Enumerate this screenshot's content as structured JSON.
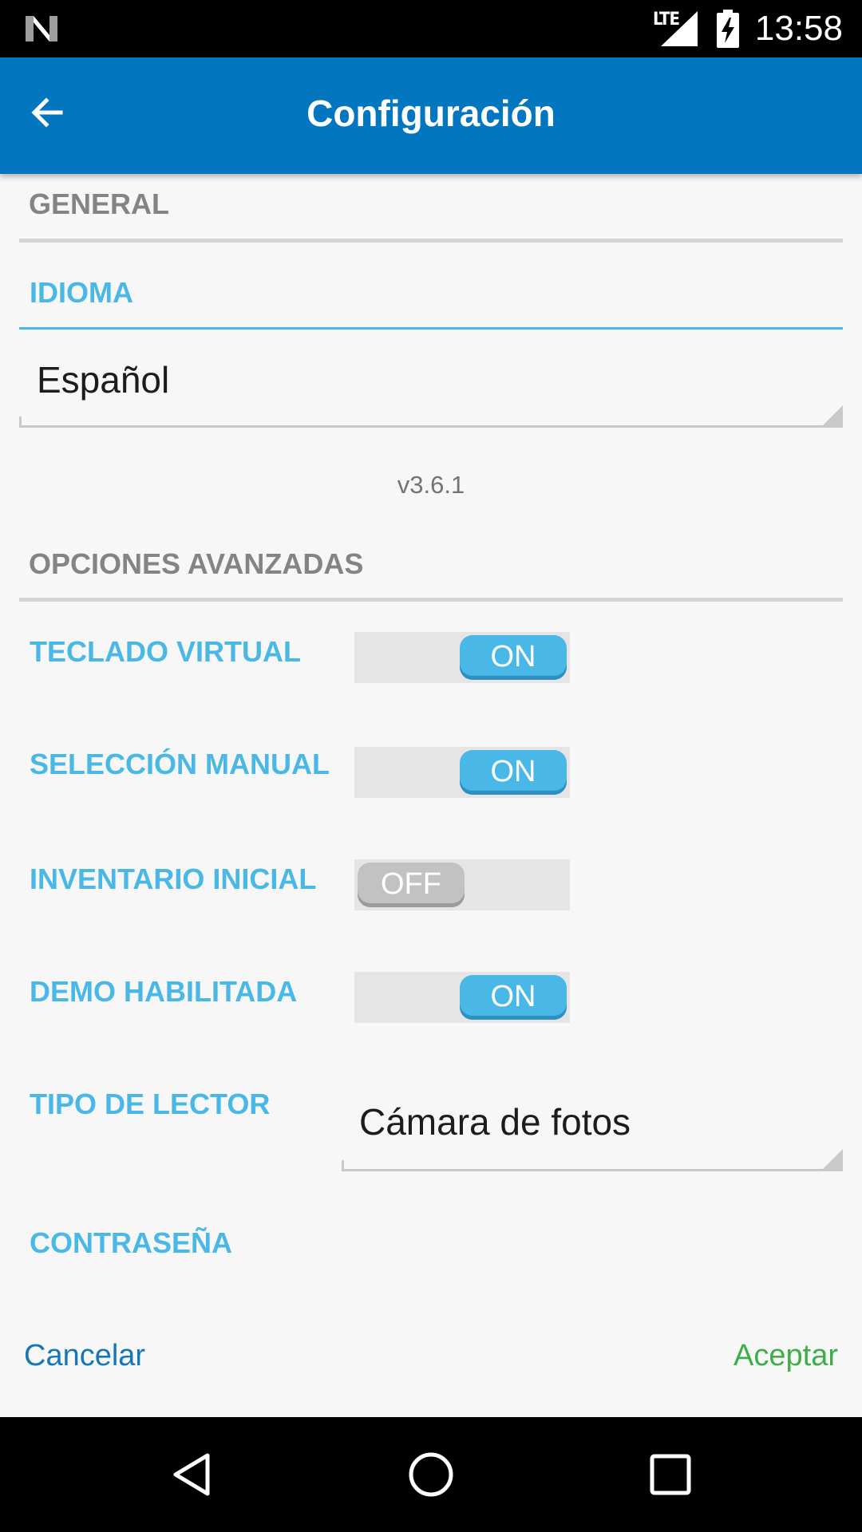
{
  "status_bar": {
    "network": "LTE",
    "time": "13:58",
    "icons": [
      "n-logo-icon",
      "signal-icon",
      "battery-charging-icon"
    ]
  },
  "app_bar": {
    "title": "Configuración",
    "back_icon": "arrow-left-icon"
  },
  "general": {
    "header": "GENERAL",
    "language_label": "IDIOMA",
    "language_value": "Español",
    "version": "v3.6.1"
  },
  "advanced": {
    "header": "OPCIONES AVANZADAS",
    "options": [
      {
        "label": "TECLADO VIRTUAL",
        "state": "ON",
        "enabled": true
      },
      {
        "label": "SELECCIÓN MANUAL",
        "state": "ON",
        "enabled": true
      },
      {
        "label": "INVENTARIO INICIAL",
        "state": "OFF",
        "enabled": false
      },
      {
        "label": "DEMO HABILITADA",
        "state": "ON",
        "enabled": true
      }
    ],
    "reader_label": "TIPO DE LECTOR",
    "reader_value": "Cámara de fotos",
    "password_label": "CONTRASEÑA"
  },
  "actions": {
    "cancel": "Cancelar",
    "accept": "Aceptar"
  },
  "nav_bar": {
    "icons": [
      "back-triangle-icon",
      "home-circle-icon",
      "recents-square-icon"
    ]
  },
  "colors": {
    "app_bar": "#0277bf",
    "accent_label": "#4ab8e6",
    "cancel": "#1677b8",
    "accept": "#3fae49"
  }
}
